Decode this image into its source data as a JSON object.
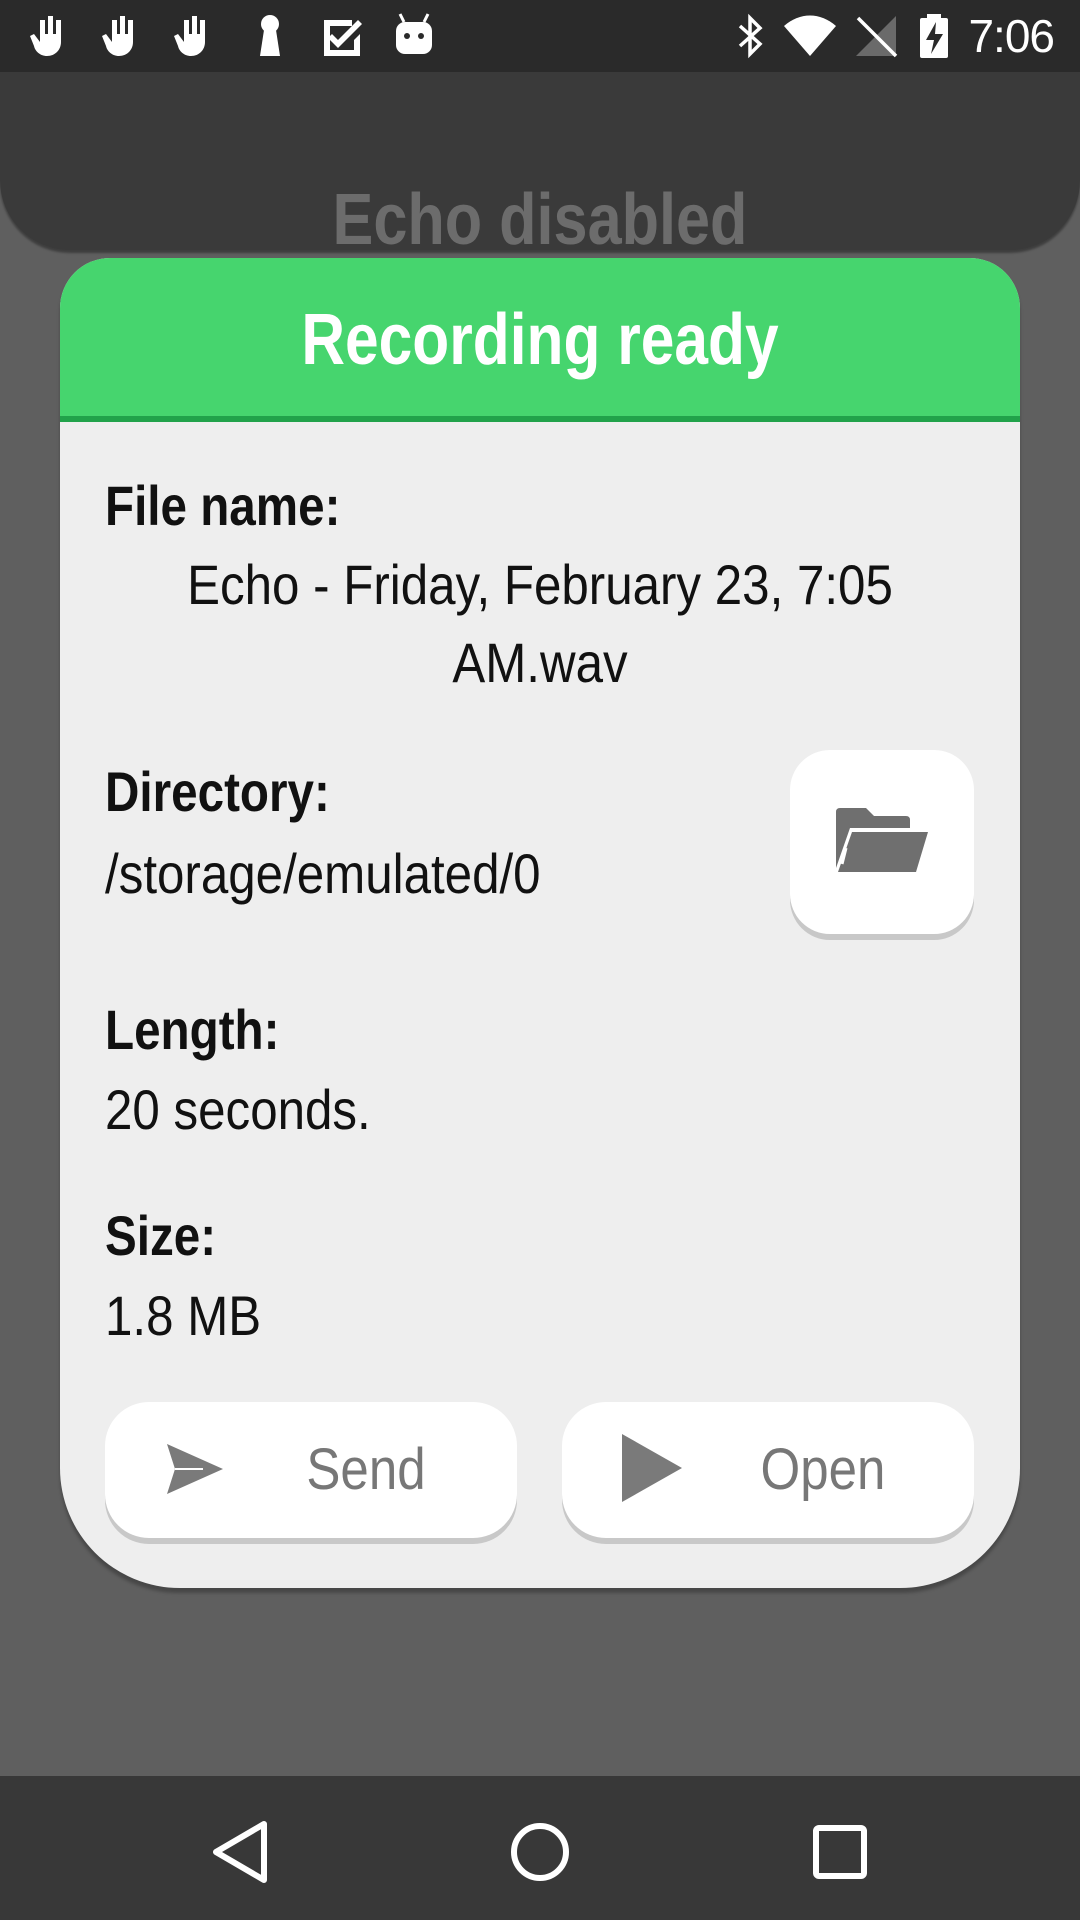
{
  "status_bar": {
    "time": "7:06",
    "left_icons": [
      "hand-notification-icon",
      "hand-notification-icon",
      "hand-notification-icon",
      "keyhole-icon",
      "checkbox-icon",
      "android-icon"
    ],
    "right_icons": [
      "bluetooth-icon",
      "wifi-icon",
      "no-signal-icon",
      "battery-charging-icon"
    ]
  },
  "background": {
    "header_title": "Echo disabled"
  },
  "dialog": {
    "title": "Recording ready",
    "header_color": "#46d56e",
    "file_name_label": "File name:",
    "file_name_line1": "Echo - Friday, February 23, 7:05",
    "file_name_line2": "AM.wav",
    "directory_label": "Directory:",
    "directory_value": "/storage/emulated/0",
    "length_label": "Length:",
    "length_value": "20 seconds.",
    "size_label": "Size:",
    "size_value": "1.8 MB",
    "folder_button_icon": "folder-icon",
    "send_label": "Send",
    "open_label": "Open"
  },
  "nav_bar": {
    "icons": [
      "back-icon",
      "home-icon",
      "recents-icon"
    ]
  }
}
